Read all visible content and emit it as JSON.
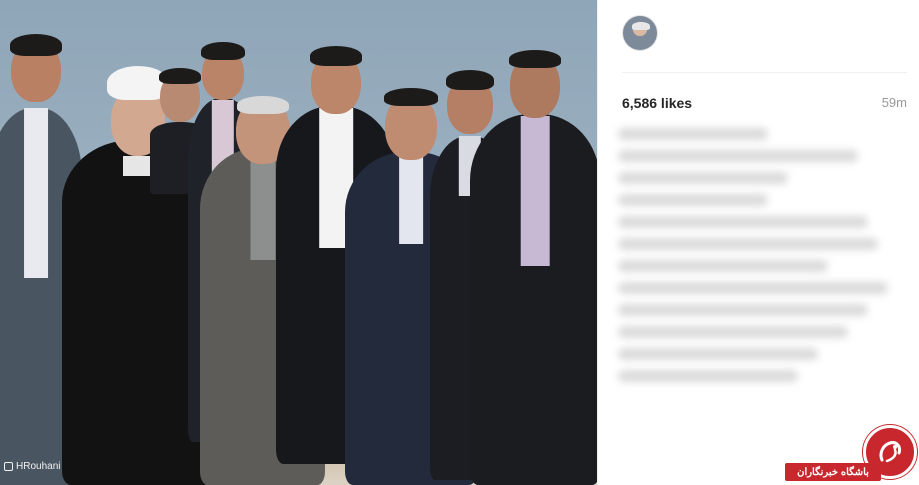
{
  "photo": {
    "credit": "HRouhani"
  },
  "post": {
    "likes": "6,586 likes",
    "time": "59m"
  },
  "watermark": {
    "text": "باشگاه خبرنگاران"
  },
  "colors": {
    "watermark_red": "#c8282d",
    "likes_text": "#262626",
    "muted_text": "#999999"
  }
}
